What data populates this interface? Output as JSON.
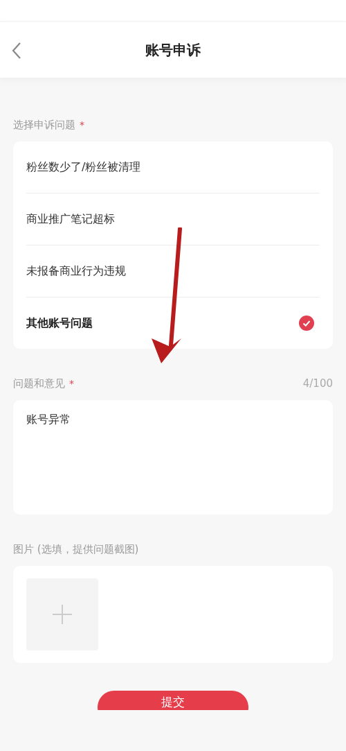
{
  "header": {
    "title": "账号申诉"
  },
  "issue_section": {
    "label": "选择申诉问题",
    "required_mark": "*",
    "options": [
      {
        "label": "粉丝数少了/粉丝被清理",
        "selected": false
      },
      {
        "label": "商业推广笔记超标",
        "selected": false
      },
      {
        "label": "未报备商业行为违规",
        "selected": false
      },
      {
        "label": "其他账号问题",
        "selected": true
      }
    ]
  },
  "feedback_section": {
    "label": "问题和意见",
    "required_mark": "*",
    "counter": "4/100",
    "value": "账号异常"
  },
  "image_section": {
    "label": "图片 (选填，提供问题截图)"
  },
  "submit_button": {
    "label": "提交"
  }
}
